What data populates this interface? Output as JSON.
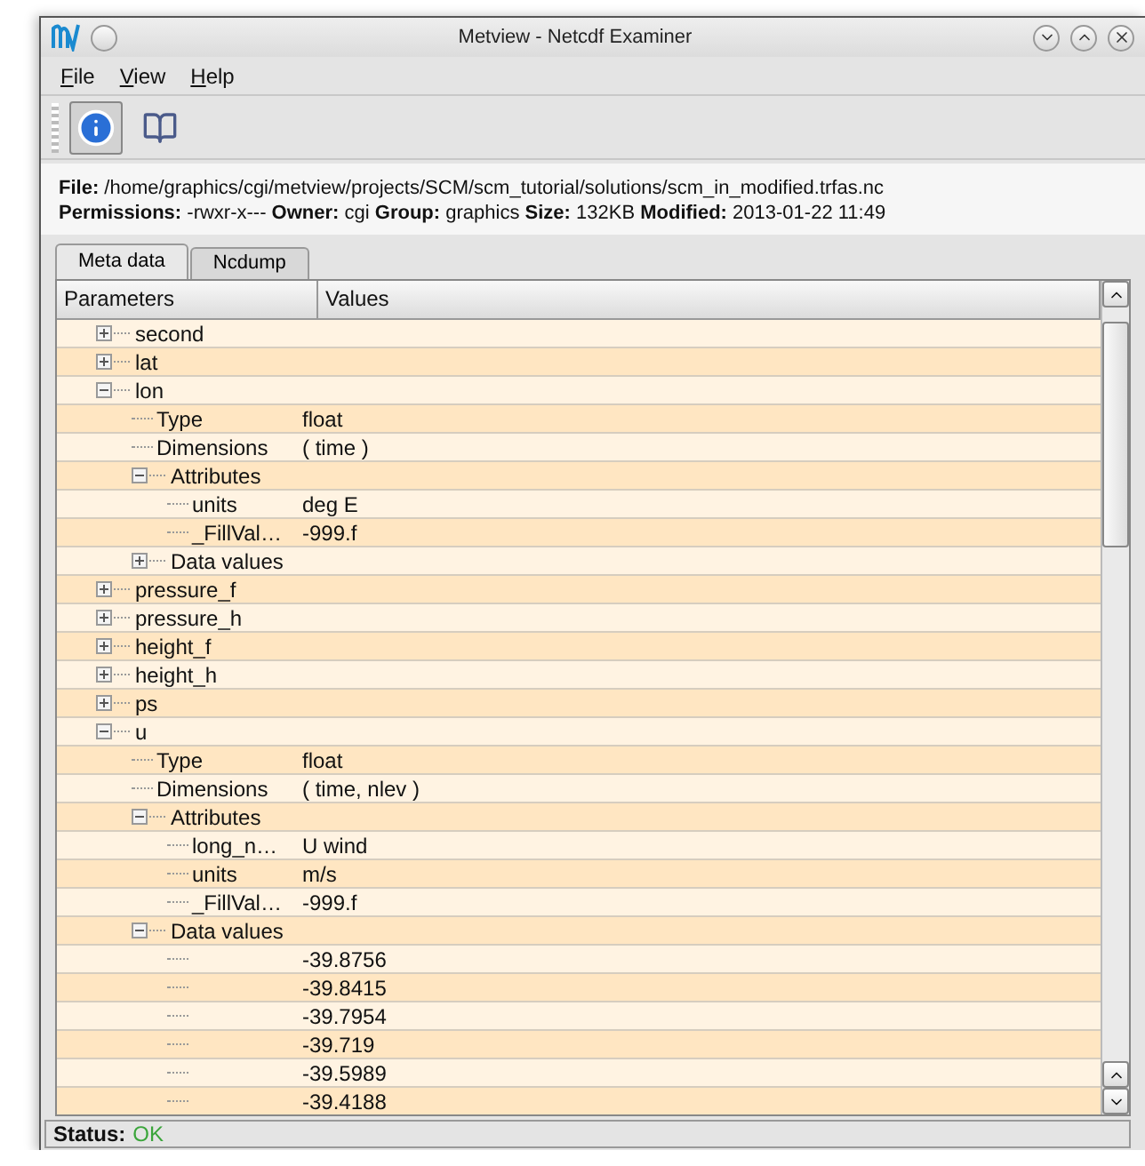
{
  "window": {
    "title": "Metview - Netcdf Examiner"
  },
  "menu": [
    {
      "label": "File"
    },
    {
      "label": "View"
    },
    {
      "label": "Help"
    }
  ],
  "toolbar": [
    {
      "kind": "info",
      "selected": true
    },
    {
      "kind": "book",
      "selected": false
    }
  ],
  "info": [
    "**File:** /home/graphics/cgi/metview/projects/SCM/scm_tutorial/solutions/scm_in_modified.trfas.nc",
    "**Permissions:** -rwxr-x--- **Owner:** cgi **Group:** graphics **Size:** 132KB **Modified:** 2013-01-22 11:49"
  ],
  "tabs": [
    {
      "label": "Meta data",
      "selected": true
    },
    {
      "label": "Ncdump",
      "selected": false
    }
  ],
  "table": {
    "columns": [
      "Parameters",
      "Values"
    ],
    "tree": [
      {
        "name": "second",
        "expanded": false
      },
      {
        "name": "lat",
        "expanded": false
      },
      {
        "name": "lon",
        "expanded": true,
        "children": [
          {
            "name": "Type",
            "value": "float"
          },
          {
            "name": "Dimensions",
            "value": " ( time )"
          },
          {
            "name": "Attributes",
            "expanded": true,
            "children": [
              {
                "name": "units",
                "value": "deg E"
              },
              {
                "name": "_FillVal…",
                "value": "-999.f"
              }
            ]
          },
          {
            "name": "Data values",
            "expanded": false
          }
        ]
      },
      {
        "name": "pressure_f",
        "expanded": false
      },
      {
        "name": "pressure_h",
        "expanded": false
      },
      {
        "name": "height_f",
        "expanded": false
      },
      {
        "name": "height_h",
        "expanded": false
      },
      {
        "name": "ps",
        "expanded": false
      },
      {
        "name": "u",
        "expanded": true,
        "children": [
          {
            "name": "Type",
            "value": "float"
          },
          {
            "name": "Dimensions",
            "value": " ( time, nlev )"
          },
          {
            "name": "Attributes",
            "expanded": true,
            "children": [
              {
                "name": "long_n…",
                "value": "U wind"
              },
              {
                "name": "units",
                "value": "m/s"
              },
              {
                "name": "_FillVal…",
                "value": "-999.f"
              }
            ]
          },
          {
            "name": "Data values",
            "expanded": true,
            "children": [
              {
                "value": "-39.8756"
              },
              {
                "value": "-39.8415"
              },
              {
                "value": "-39.7954"
              },
              {
                "value": "-39.719"
              },
              {
                "value": "-39.5989"
              },
              {
                "value": "-39.4188"
              }
            ]
          }
        ]
      }
    ]
  },
  "status_bar": {
    "label": "Status:",
    "value": "OK"
  }
}
